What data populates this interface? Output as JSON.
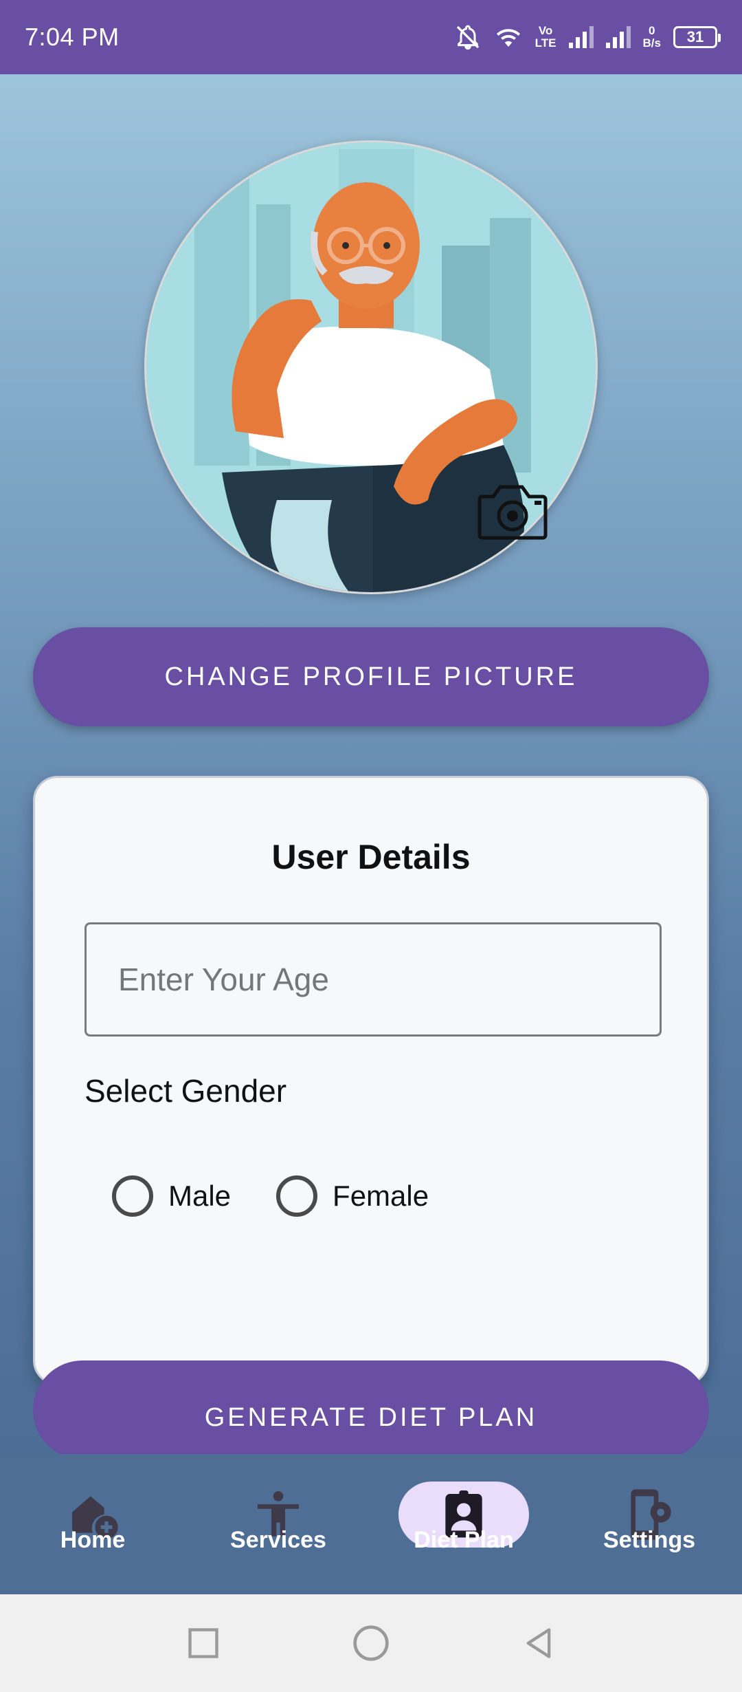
{
  "status_bar": {
    "time": "7:04 PM",
    "lte_top": "Vo",
    "lte_bottom": "LTE",
    "net_speed_value": "0",
    "net_speed_unit": "B/s",
    "battery": "31"
  },
  "profile": {
    "change_picture_label": "CHANGE PROFILE PICTURE"
  },
  "user_details": {
    "title": "User Details",
    "age_placeholder": "Enter Your Age",
    "age_value": "",
    "gender_label": "Select Gender",
    "gender_options": [
      "Male",
      "Female"
    ]
  },
  "actions": {
    "generate_label": "GENERATE DIET PLAN"
  },
  "bottom_nav": {
    "items": [
      {
        "label": "Home",
        "icon": "home-add-icon"
      },
      {
        "label": "Services",
        "icon": "accessibility-icon"
      },
      {
        "label": "Diet Plan",
        "icon": "contact-badge-icon",
        "active": true
      },
      {
        "label": "Settings",
        "icon": "phone-settings-icon"
      }
    ]
  },
  "colors": {
    "primary": "#694fa3",
    "nav_active_pill": "#e9ddfb",
    "card_bg": "#f7f8fa"
  }
}
